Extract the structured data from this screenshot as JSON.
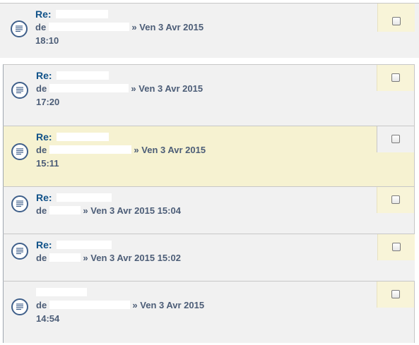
{
  "posts": [
    {
      "title": "Re:",
      "de": "de",
      "date": "» Ven 3 Avr 2015",
      "time": "18:10"
    },
    {
      "title": "Re:",
      "de": "de",
      "date": "» Ven 3 Avr 2015",
      "time": "17:20"
    },
    {
      "title": "Re:",
      "de": "de",
      "date": "» Ven 3 Avr 2015",
      "time": "15:11"
    },
    {
      "title": "Re:",
      "de": "de",
      "date": "» Ven 3 Avr 2015 15:04"
    },
    {
      "title": "Re:",
      "de": "de",
      "date": "» Ven 3 Avr 2015 15:02"
    },
    {
      "title": "",
      "de": "de",
      "date": "» Ven 3 Avr 2015",
      "time": "14:54"
    }
  ],
  "icons": {
    "post": "topic-icon"
  },
  "colors": {
    "title": "#105289",
    "meta": "#4c5d77",
    "highlight": "#f6f2d1",
    "checkbox_cell": "#f8f4d8"
  }
}
